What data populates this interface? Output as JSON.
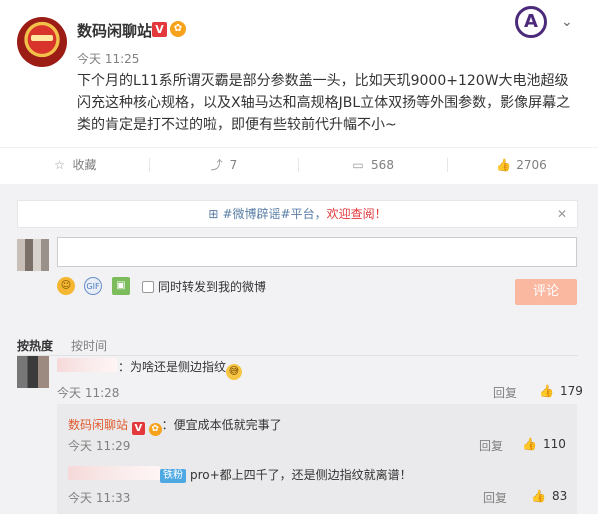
{
  "post": {
    "author": "数码闲聊站",
    "verify_badge": "V",
    "medal_glyph": "✿",
    "time": "今天 11:25",
    "text": "下个月的L11系所谓灭霸是部分参数盖一头，比如天玑9000+120W大电池超级闪充这种核心规格，以及X轴马达和高规格JBL立体双扬等外围参数，影像屏幕之类的肯定是打不过的啦，即便有些较前代升幅不小~",
    "avengers_glyph": "A",
    "more_glyph": "⌄"
  },
  "actions": {
    "favorite": {
      "icon": "star-icon",
      "glyph": "☆",
      "label": "收藏"
    },
    "repost": {
      "icon": "repost-icon",
      "glyph": "⤴",
      "label": "7"
    },
    "comment": {
      "icon": "comment-icon",
      "glyph": "▭",
      "label": "568"
    },
    "like": {
      "icon": "like-icon",
      "glyph": "👍",
      "label": "2706"
    }
  },
  "notice": {
    "hash": "⊞",
    "topic": "#微博辟谣#平台，",
    "welcome": "欢迎查阅！",
    "close": "✕"
  },
  "composer": {
    "placeholder": "",
    "sync_label": "同时转发到我的微博",
    "submit_label": "评论",
    "smile_glyph": "☺",
    "gif_glyph": "GIF",
    "image_glyph": "▣"
  },
  "sort": {
    "by_hot": "按热度",
    "by_time": "按时间"
  },
  "comments": [
    {
      "text": "：为啥还是侧边指纹",
      "emoji": "😅",
      "time": "今天 11:28",
      "reply": "回复",
      "likes": "179"
    }
  ],
  "replies": [
    {
      "author": "数码闲聊站",
      "verify": "V",
      "medal": "✿",
      "text": "：便宜成本低就完事了",
      "time": "今天 11:29",
      "reply": "回复",
      "likes": "110"
    },
    {
      "fan_badge": "铁粉",
      "text": "pro+都上四千了，还是侧边指纹就离谱！",
      "time": "今天 11:33",
      "reply": "回复",
      "likes": "83"
    }
  ],
  "colors": {
    "accent": "#e15a2e",
    "verify": "#e4393c",
    "submit_disabled": "#fbb8a1",
    "link": "#5a7ea6"
  }
}
